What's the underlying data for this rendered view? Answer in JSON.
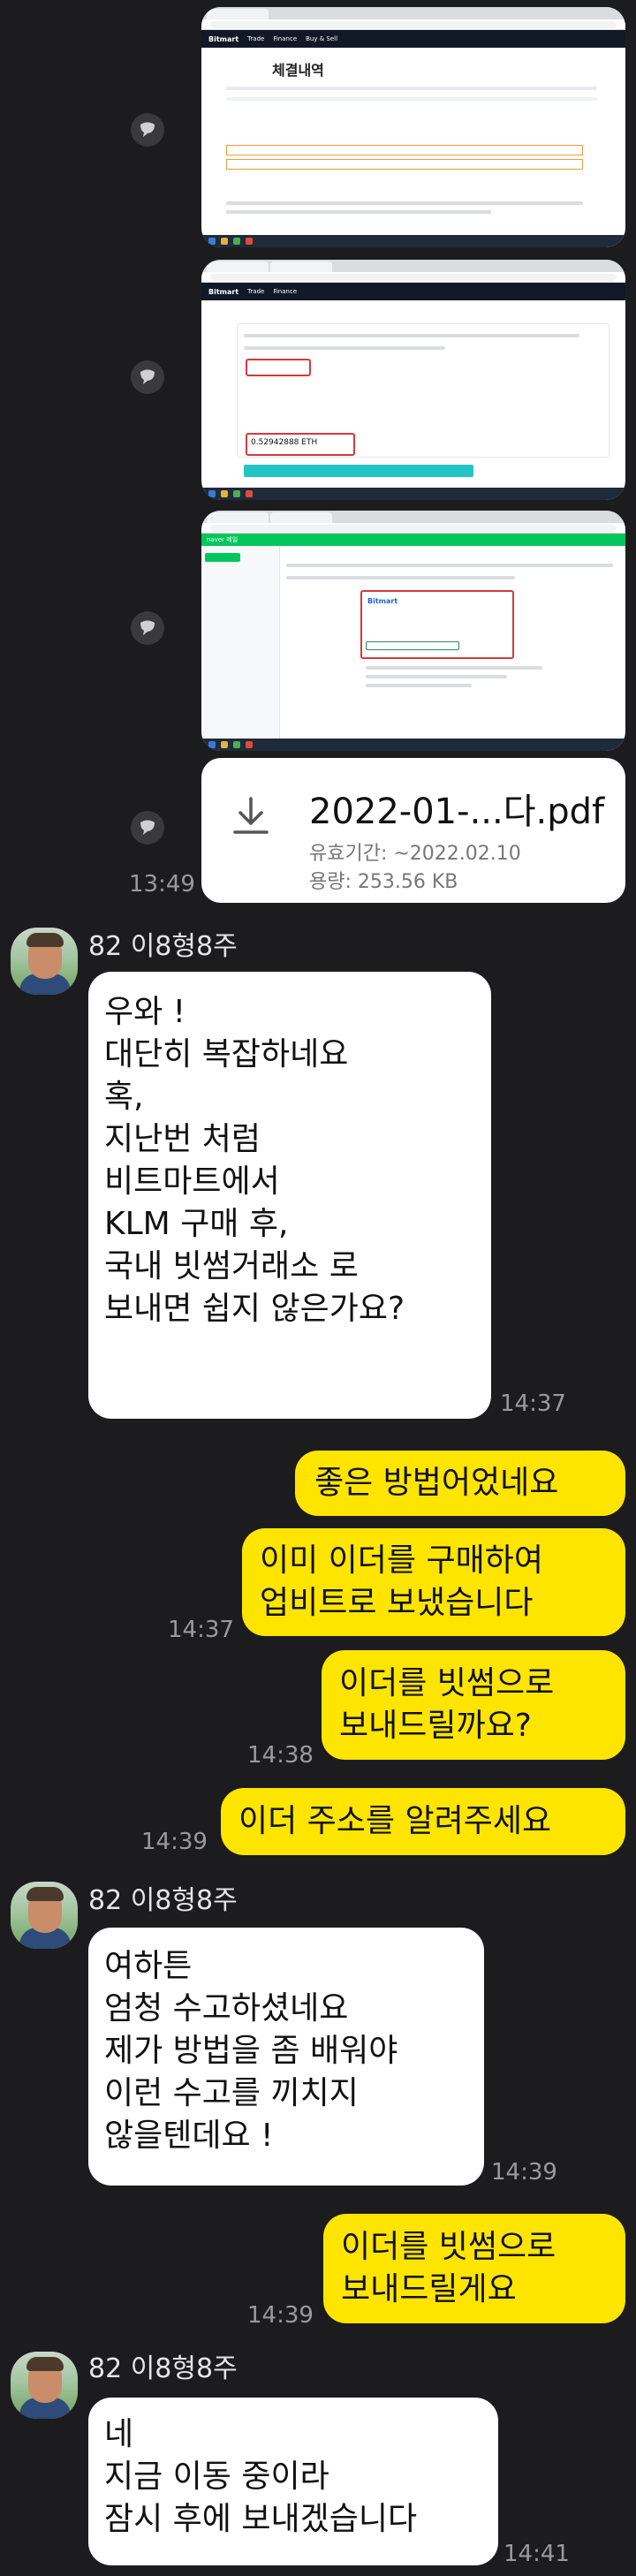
{
  "screenshots": [
    {
      "page_title": "체결내역",
      "site": "Bitmart"
    },
    {
      "site": "Bitmart",
      "amount": "0.52942888 ETH"
    },
    {
      "site": "Bitmart",
      "app": "naver 메일"
    }
  ],
  "file": {
    "name": "2022-01-...다.pdf",
    "expiry": "유효기간: ~2022.02.10",
    "size": "용량: 253.56 KB",
    "time": "13:49"
  },
  "messages": [
    {
      "type": "sender",
      "text": "82 이8형8주"
    },
    {
      "type": "in",
      "text": "우와 !\n대단히 복잡하네요\n혹,\n지난번 처럼\n비트마트에서\nKLM 구매 후,\n국내 빗썸거래소 로\n보내면 쉽지 않은가요?",
      "time": "14:37"
    },
    {
      "type": "out",
      "text": "좋은 방법어었네요",
      "time": ""
    },
    {
      "type": "out",
      "text": "이미 이더를 구매하여\n업비트로 보냈습니다",
      "time": "14:37"
    },
    {
      "type": "out",
      "text": "이더를 빗썸으로\n보내드릴까요?",
      "time": "14:38"
    },
    {
      "type": "out",
      "text": "이더 주소를 알려주세요",
      "time": "14:39"
    },
    {
      "type": "sender",
      "text": "82 이8형8주"
    },
    {
      "type": "in",
      "text": "여하튼\n엄청 수고하셨네요\n제가 방법을 좀 배워야\n이런 수고를 끼치지\n않을텐데요 !",
      "time": "14:39"
    },
    {
      "type": "out",
      "text": "이더를 빗썸으로\n보내드릴게요",
      "time": "14:39"
    },
    {
      "type": "sender",
      "text": "82 이8형8주"
    },
    {
      "type": "in",
      "text": "네\n지금 이동 중이라\n잠시 후에 보내겠습니다",
      "time": "14:41"
    }
  ]
}
